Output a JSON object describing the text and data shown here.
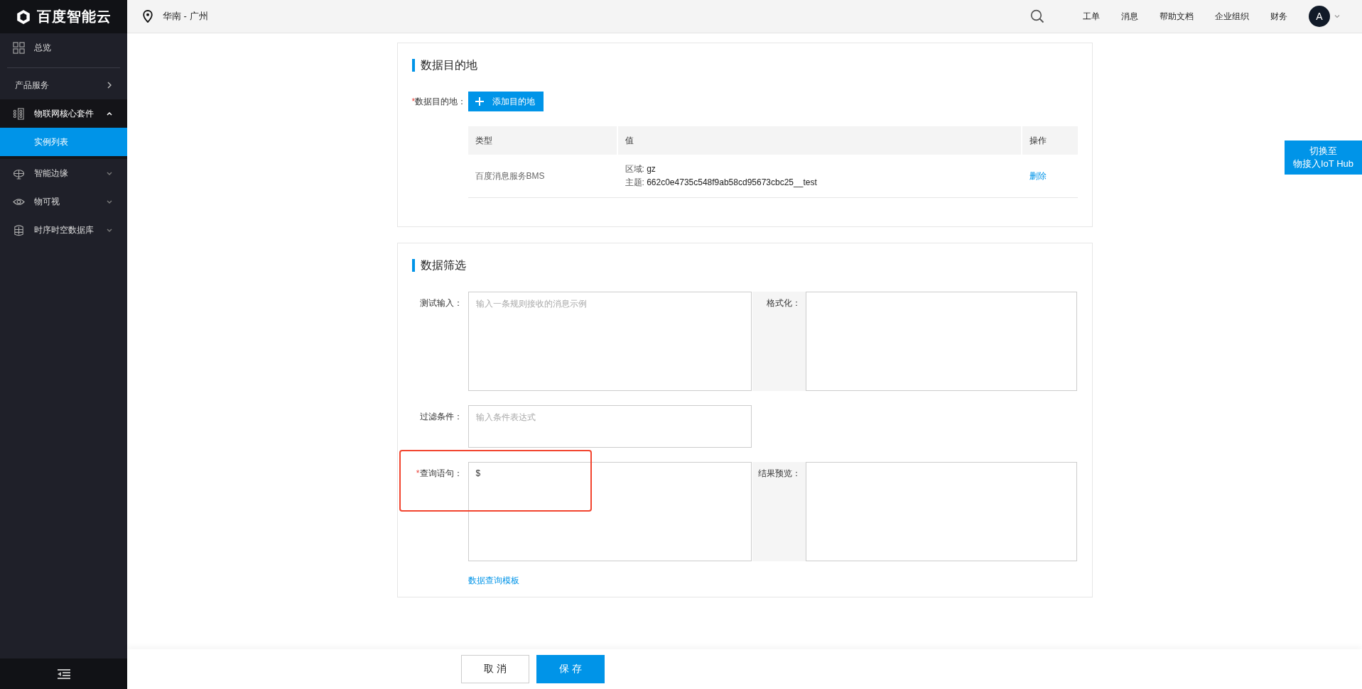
{
  "brand": {
    "name": "百度智能云"
  },
  "header": {
    "region": "华南 - 广州",
    "nav": [
      "工单",
      "消息",
      "帮助文档",
      "企业组织",
      "财务"
    ],
    "avatar": "A"
  },
  "sidebar": {
    "items": [
      {
        "label": "总览",
        "kind": "link",
        "selected": false
      },
      {
        "label": "产品服务",
        "kind": "menu",
        "selected": false
      },
      {
        "label": "物联网核心套件",
        "kind": "group",
        "expanded": true,
        "selected": false,
        "children": [
          {
            "label": "实例列表",
            "selected": true
          }
        ]
      },
      {
        "label": "智能边缘",
        "kind": "group",
        "expanded": false,
        "selected": false
      },
      {
        "label": "物可视",
        "kind": "group",
        "expanded": false,
        "selected": false
      },
      {
        "label": "时序时空数据库",
        "kind": "group",
        "expanded": false,
        "selected": false
      }
    ]
  },
  "switch_button": {
    "lines": [
      "切换至",
      "物接入IoT Hub"
    ]
  },
  "destination_section": {
    "title": "数据目的地",
    "label": "数据目的地：",
    "required_mark": "*",
    "add_button": "添加目的地",
    "table": {
      "columns": [
        "类型",
        "值",
        "操作"
      ],
      "rows": [
        {
          "type": "百度消息服务BMS",
          "value_lines": [
            {
              "key": "区域:",
              "value": "gz"
            },
            {
              "key": "主题:",
              "value": "662c0e4735c548f9ab58cd95673cbc25__test"
            }
          ],
          "action": "删除"
        }
      ]
    }
  },
  "filter_section": {
    "title": "数据筛选",
    "fields": [
      {
        "label": "测试输入：",
        "placeholder": "输入一条规则接收的消息示例",
        "side_label": "格式化："
      },
      {
        "label": "过滤条件：",
        "placeholder": "输入条件表达式"
      },
      {
        "label": "查询语句：",
        "required_mark": "*",
        "value": "$",
        "side_label": "结果预览：",
        "highlighted": true
      }
    ],
    "template_link": "数据查询模板"
  },
  "footer": {
    "cancel": "取 消",
    "save": "保 存"
  }
}
